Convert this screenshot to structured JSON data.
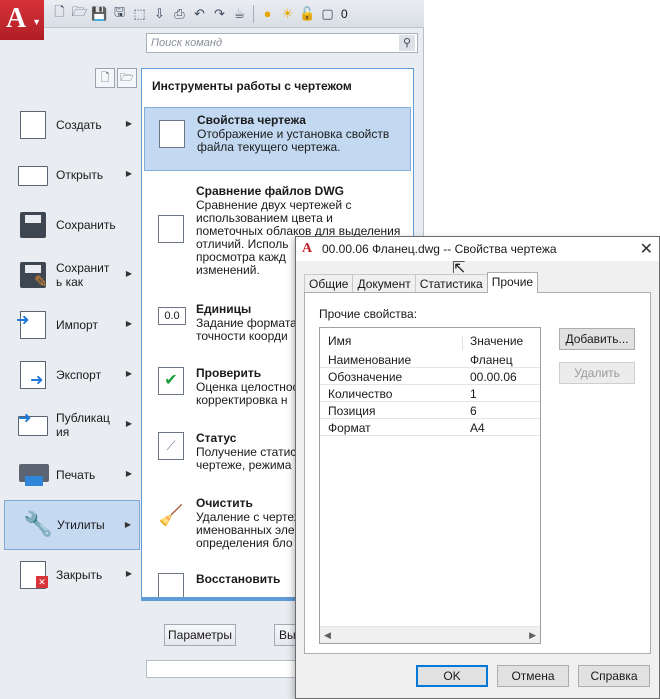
{
  "app": {
    "logo_letter": "A",
    "search_placeholder": "Поиск команд",
    "layer_value": "0"
  },
  "menu": {
    "items": [
      {
        "label": "Создать",
        "icon": "new-document-icon",
        "has_submenu": true
      },
      {
        "label": "Открыть",
        "icon": "open-folder-icon",
        "has_submenu": true
      },
      {
        "label": "Сохранить",
        "icon": "save-icon",
        "has_submenu": false
      },
      {
        "label": "Сохранить как",
        "icon": "save-as-icon",
        "has_submenu": true
      },
      {
        "label": "Импорт",
        "icon": "import-icon",
        "has_submenu": true
      },
      {
        "label": "Экспорт",
        "icon": "export-icon",
        "has_submenu": true
      },
      {
        "label": "Публикация",
        "icon": "publish-icon",
        "has_submenu": true
      },
      {
        "label": "Печать",
        "icon": "print-icon",
        "has_submenu": true
      },
      {
        "label": "Утилиты",
        "icon": "utilities-wrench-icon",
        "has_submenu": true,
        "selected": true
      },
      {
        "label": "Закрыть",
        "icon": "close-document-icon",
        "has_submenu": true
      }
    ],
    "item_label_lines": {
      "save_as": [
        "Сохранит",
        "ь как"
      ],
      "publish": [
        "Публикац",
        "ия"
      ]
    }
  },
  "submenu": {
    "title": "Инструменты работы с чертежом",
    "items": [
      {
        "title": "Свойства чертежа",
        "desc": "Отображение и установка свойств\nфайла текущего чертежа.",
        "icon": "drawing-properties-icon",
        "selected": true
      },
      {
        "title": "Сравнение файлов DWG",
        "desc": "Сравнение двух чертежей с\nиспользованием цвета и\nпометочных облаков для выделения\nотличий. Исполь\nпросмотра кажд\nизменений.",
        "icon": "dwg-compare-icon"
      },
      {
        "title": "Единицы",
        "desc": "Задание формата\nточности коорди",
        "icon": "units-icon"
      },
      {
        "title": "Проверить",
        "desc": "Оценка целостност\nкорректировка н",
        "icon": "audit-check-icon"
      },
      {
        "title": "Статус",
        "desc": "Получение статис\nчертеже, режима",
        "icon": "status-icon"
      },
      {
        "title": "Очистить",
        "desc": "Удаление с чертеж\nименованных эле\nопределения бло",
        "icon": "purge-broom-icon"
      },
      {
        "title": "Восстановить",
        "desc": "",
        "icon": "recover-icon"
      }
    ]
  },
  "footer": {
    "options_label": "Параметры",
    "exit_label": "Вы"
  },
  "dialog": {
    "title": "00.00.06 Фланец.dwg -- Свойства чертежа",
    "tabs": [
      "Общие",
      "Документ",
      "Статистика",
      "Прочие"
    ],
    "active_tab": "Прочие",
    "section_label": "Прочие свойства:",
    "columns": {
      "name": "Имя",
      "value": "Значение"
    },
    "rows": [
      {
        "name": "Наименование",
        "value": "Фланец"
      },
      {
        "name": "Обозначение",
        "value": "00.00.06"
      },
      {
        "name": "Количество",
        "value": "1"
      },
      {
        "name": "Позиция",
        "value": "6"
      },
      {
        "name": "Формат",
        "value": "A4"
      }
    ],
    "add_label": "Добавить...",
    "delete_label": "Удалить",
    "ok_label": "OK",
    "cancel_label": "Отмена",
    "help_label": "Справка"
  },
  "colors": {
    "accent": "#5f9bd6",
    "selected_bg": "#c3d9f2",
    "logo_red": "#c4202a"
  }
}
